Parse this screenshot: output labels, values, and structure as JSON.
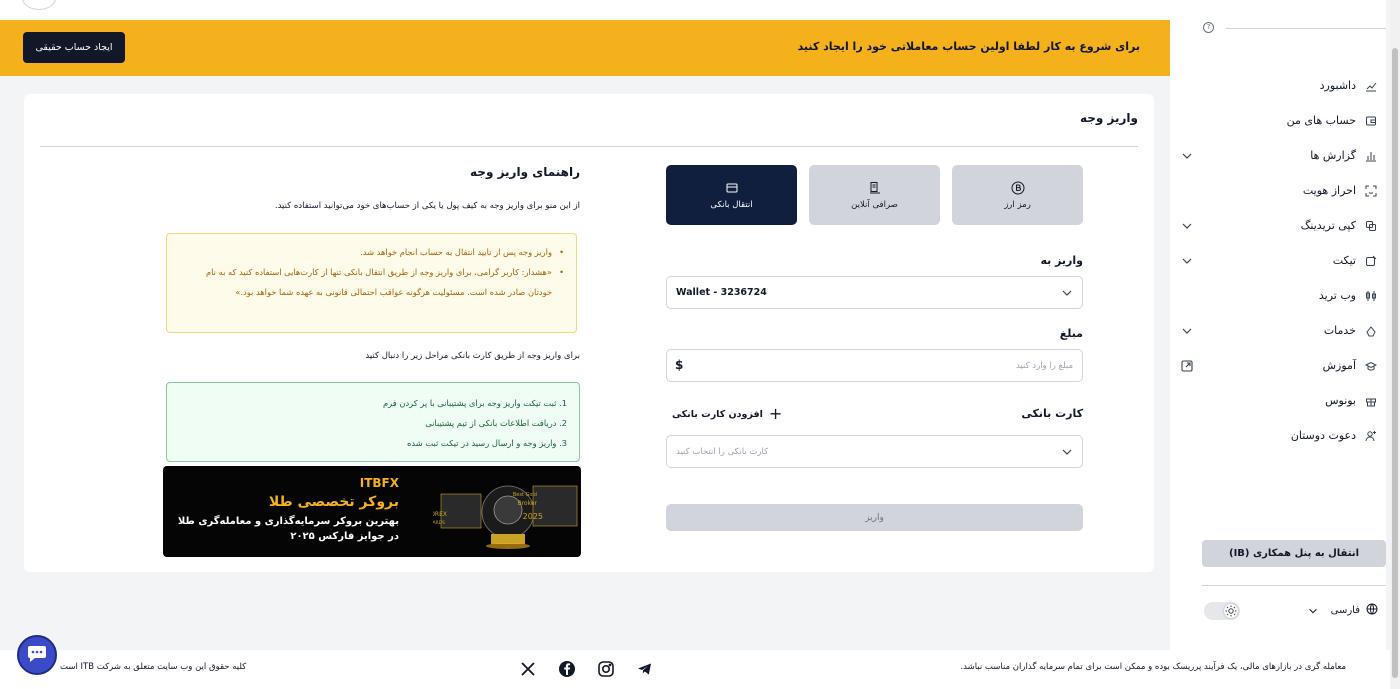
{
  "banner": {
    "message": "برای شروع به کار لطفا اولین حساب معاملاتی خود را ایجاد کنید",
    "cta_label": "ایجاد حساب حقیقی"
  },
  "sidebar": {
    "items": [
      {
        "label": "داشبورد",
        "icon": "dashboard-icon",
        "has_chevron": false
      },
      {
        "label": "حساب های من",
        "icon": "wallet-icon",
        "has_chevron": false
      },
      {
        "label": "گزارش ها",
        "icon": "bar-chart-icon",
        "has_chevron": true
      },
      {
        "label": "احراز هویت",
        "icon": "face-scan-icon",
        "has_chevron": false
      },
      {
        "label": "کپی تریدینگ",
        "icon": "copy-icon",
        "has_chevron": true
      },
      {
        "label": "تیکت",
        "icon": "ticket-icon",
        "has_chevron": true
      },
      {
        "label": "وب ترید",
        "icon": "web-trade-icon",
        "has_chevron": false
      },
      {
        "label": "خدمات",
        "icon": "services-icon",
        "has_chevron": true
      },
      {
        "label": "آموزش",
        "icon": "graduation-icon",
        "has_external": true
      },
      {
        "label": "بونوس",
        "icon": "gift-icon",
        "has_chevron": false
      },
      {
        "label": "دعوت دوستان",
        "icon": "user-plus-icon",
        "has_chevron": false
      }
    ],
    "ib_button": "انتقال به پنل همکاری (IB)",
    "language": "فارسی"
  },
  "page": {
    "title": "واریز وجه"
  },
  "methods": [
    {
      "label": "رمز ارز",
      "icon": "bitcoin-icon",
      "active": false
    },
    {
      "label": "صرافی آنلاین",
      "icon": "exchange-icon",
      "active": false
    },
    {
      "label": "انتقال بانکی",
      "icon": "card-icon",
      "active": true
    }
  ],
  "form": {
    "deposit_to_label": "واریز به",
    "deposit_to_value": "Wallet - 3236724",
    "amount_label": "مبلغ",
    "amount_placeholder": "مبلغ را وارد کنید",
    "currency_symbol": "$",
    "bank_card_label": "کارت بانکی",
    "add_card_label": "افزودن کارت بانکی",
    "bank_card_placeholder": "کارت بانکی را انتخاب کنید",
    "submit_label": "واریز"
  },
  "guide": {
    "title": "راهنمای واریز وجه",
    "intro": "از این منو برای واریز وجه به کیف پول یا یکی از حساب‌های خود می‌توانید استفاده کنید.",
    "warnings": [
      "واریز وجه پس از تایید انتقال به حساب انجام خواهد شد.",
      "«هشدار: کاربر گرامی، برای واریز وجه از طریق انتقال بانکی تنها از کارت‌هایی استفاده کنید که به نام خودتان صادر شده است. مسئولیت هرگونه عواقب احتمالی قانونی به عهده شما خواهد بود.»"
    ],
    "steps_intro": "برای واریز وجه از طریق کارت بانکی مراحل زیر را دنبال کنید",
    "steps": [
      "1. ثبت تیکت واریز وجه برای پشتیبانی با پر کردن فرم",
      "2. دریافت اطلاعات بانکی از تیم پشتیبانی",
      "3. واریز وجه و ارسال رسید در تیکت ثبت شده"
    ]
  },
  "promo": {
    "brand": "ITBFX",
    "headline": "بروکر تخصصی طلا",
    "line1": "بهترین بروکر سرمایه‌گذاری و معامله‌گری طلا",
    "line2": "در جوایز فارکس ۲۰۲۵",
    "award_text": "Best Gold Broker 2025",
    "award_sub": "FOREX AWARDS"
  },
  "footer": {
    "disclaimer": "معامله گری در بازارهای مالی، یک فرآیند پرریسک بوده و ممکن است برای تمام سرمایه گذاران مناسب نباشد.",
    "copyright": "کلیه حقوق این وب سایت متعلق به شرکت ITB است",
    "social": [
      "x-icon",
      "facebook-icon",
      "instagram-icon",
      "telegram-icon"
    ]
  },
  "colors": {
    "accent": "#f5b11b",
    "dark": "#0f1f3d",
    "warning_bg": "#fffbeb",
    "success_bg": "#f0fdf4"
  }
}
